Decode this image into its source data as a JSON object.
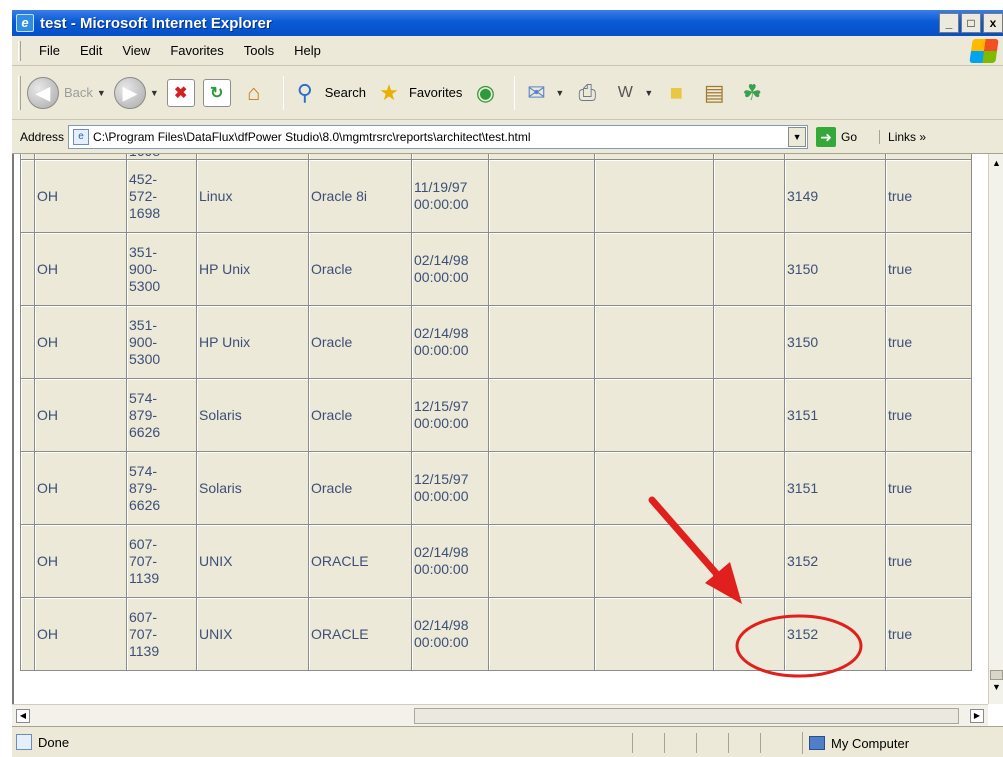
{
  "window": {
    "title": "test - Microsoft Internet Explorer",
    "min": "_",
    "max": "□",
    "close": "x"
  },
  "menu": [
    "File",
    "Edit",
    "View",
    "Favorites",
    "Tools",
    "Help"
  ],
  "toolbar": {
    "back": "Back",
    "search": "Search",
    "favorites": "Favorites"
  },
  "address": {
    "label": "Address",
    "url": "C:\\Program Files\\DataFlux\\dfPower Studio\\8.0\\mgmtrsrc\\reports\\architect\\test.html",
    "go": "Go",
    "links": "Links",
    "links_chevron": "»"
  },
  "table": {
    "partial_phone": "1698",
    "rows": [
      {
        "state": "OH",
        "phone": [
          "452-",
          "572-",
          "1698"
        ],
        "os": "Linux",
        "db": "Oracle 8i",
        "date": [
          "11/19/97",
          "00:00:00"
        ],
        "id": "3149",
        "flag": "true"
      },
      {
        "state": "OH",
        "phone": [
          "351-",
          "900-",
          "5300"
        ],
        "os": "HP Unix",
        "db": "Oracle",
        "date": [
          "02/14/98",
          "00:00:00"
        ],
        "id": "3150",
        "flag": "true"
      },
      {
        "state": "OH",
        "phone": [
          "351-",
          "900-",
          "5300"
        ],
        "os": "HP Unix",
        "db": "Oracle",
        "date": [
          "02/14/98",
          "00:00:00"
        ],
        "id": "3150",
        "flag": "true"
      },
      {
        "state": "OH",
        "phone": [
          "574-",
          "879-",
          "6626"
        ],
        "os": "Solaris",
        "db": "Oracle",
        "date": [
          "12/15/97",
          "00:00:00"
        ],
        "id": "3151",
        "flag": "true"
      },
      {
        "state": "OH",
        "phone": [
          "574-",
          "879-",
          "6626"
        ],
        "os": "Solaris",
        "db": "Oracle",
        "date": [
          "12/15/97",
          "00:00:00"
        ],
        "id": "3151",
        "flag": "true"
      },
      {
        "state": "OH",
        "phone": [
          "607-",
          "707-",
          "1139"
        ],
        "os": "UNIX",
        "db": "ORACLE",
        "date": [
          "02/14/98",
          "00:00:00"
        ],
        "id": "3152",
        "flag": "true"
      },
      {
        "state": "OH",
        "phone": [
          "607-",
          "707-",
          "1139"
        ],
        "os": "UNIX",
        "db": "ORACLE",
        "date": [
          "02/14/98",
          "00:00:00"
        ],
        "id": "3152",
        "flag": "true"
      }
    ]
  },
  "status": {
    "text": "Done",
    "zone": "My Computer"
  },
  "annotation": {
    "color": "#e0201c"
  }
}
